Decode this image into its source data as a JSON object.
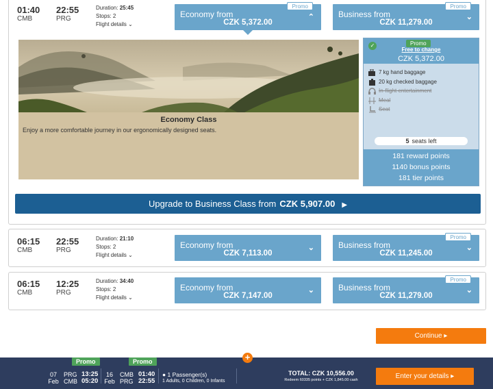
{
  "flights": [
    {
      "dep_time": "01:40",
      "dep_code": "CMB",
      "arr_time": "22:55",
      "arr_code": "PRG",
      "duration_label": "Duration:",
      "duration": "25:45",
      "stops_label": "Stops:",
      "stops": "2",
      "details_label": "Flight details",
      "economy": {
        "label": "Economy from",
        "price": "CZK 5,372.00",
        "promo": "Promo"
      },
      "business": {
        "label": "Business from",
        "price": "CZK 11,279.00",
        "promo": "Promo"
      }
    },
    {
      "dep_time": "06:15",
      "dep_code": "CMB",
      "arr_time": "22:55",
      "arr_code": "PRG",
      "duration_label": "Duration:",
      "duration": "21:10",
      "stops_label": "Stops:",
      "stops": "2",
      "details_label": "Flight details",
      "economy": {
        "label": "Economy from",
        "price": "CZK 7,113.00"
      },
      "business": {
        "label": "Business from",
        "price": "CZK 11,245.00",
        "promo": "Promo"
      }
    },
    {
      "dep_time": "06:15",
      "dep_code": "CMB",
      "arr_time": "12:25",
      "arr_code": "PRG",
      "duration_label": "Duration:",
      "duration": "34:40",
      "stops_label": "Stops:",
      "stops": "2",
      "details_label": "Flight details",
      "economy": {
        "label": "Economy from",
        "price": "CZK 7,147.00"
      },
      "business": {
        "label": "Business from",
        "price": "CZK 11,279.00",
        "promo": "Promo"
      }
    }
  ],
  "economy_panel": {
    "title": "Economy Class",
    "description": "Enjoy a more comfortable journey in our ergonomically designed seats."
  },
  "fare_box": {
    "promo": "Promo",
    "free_to_change": "Free to change",
    "price": "CZK 5,372.00",
    "features": [
      {
        "icon": "hand-baggage-icon",
        "text": "7 kg hand baggage",
        "included": true
      },
      {
        "icon": "checked-baggage-icon",
        "text": "20 kg checked baggage",
        "included": true
      },
      {
        "icon": "headphones-icon",
        "text": "In-flight entertainment",
        "included": false
      },
      {
        "icon": "meal-icon",
        "text": "Meal",
        "included": false
      },
      {
        "icon": "seat-icon",
        "text": "Seat",
        "included": false
      }
    ],
    "seats_count": "5",
    "seats_label": "seats left",
    "reward_points": "181 reward points",
    "bonus_points": "1140 bonus points",
    "tier_points": "181 tier points"
  },
  "upgrade": {
    "label": "Upgrade to Business Class from",
    "price": "CZK 5,907.00"
  },
  "continue_label": "Continue",
  "footer": {
    "promo1": "Promo",
    "promo2": "Promo",
    "leg1": {
      "day": "07",
      "month": "Feb",
      "from_code": "PRG",
      "to_code": "CMB",
      "dep": "13:25",
      "arr": "05:20"
    },
    "leg2": {
      "day": "16",
      "month": "Feb",
      "from_code": "CMB",
      "to_code": "PRG",
      "dep": "01:40",
      "arr": "22:55"
    },
    "passengers": "1 Passenger(s)",
    "passenger_breakdown": "1 Adults, 0 Children, 0 Infants",
    "total": "TOTAL: CZK 10,556.00",
    "redeem": "Redeem 60335 points + CZK 1,845.00 cash",
    "enter_details": "Enter your details"
  },
  "colors": {
    "fare_blue": "#6aa5cb",
    "upgrade_blue": "#1c5f93",
    "orange": "#f47b0e",
    "promo_green": "#4fa35a",
    "footer_navy": "#2e3d5e"
  }
}
